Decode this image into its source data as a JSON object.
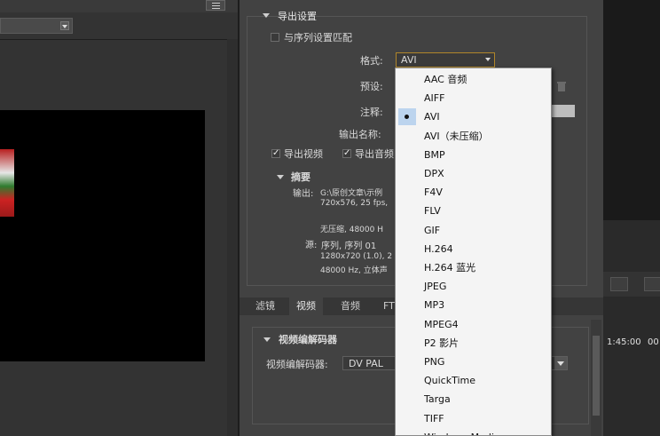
{
  "export_settings": {
    "section_title": "导出设置",
    "match_sequence_label": "与序列设置匹配",
    "format_label": "格式:",
    "format_value": "AVI",
    "preset_label": "预设:",
    "notes_label": "注释:",
    "output_name_label": "输出名称:",
    "export_video_label": "导出视频",
    "export_audio_label": "导出音频",
    "summary_title": "摘要",
    "output_label": "输出:",
    "output_path": "G:\\原创文章\\示例",
    "output_spec": "720x576, 25 fps,",
    "output_audio": "无压缩, 48000 H",
    "source_label": "源:",
    "source_sequence": "序列, 序列 01",
    "source_spec": "1280x720 (1.0), 2",
    "source_audio": "48000 Hz, 立体声"
  },
  "tabs": [
    {
      "label": "滤镜",
      "active": false
    },
    {
      "label": "视频",
      "active": true
    },
    {
      "label": "音频",
      "active": false
    },
    {
      "label": "FT",
      "active": false
    }
  ],
  "video_codec": {
    "section_title": "视频编解码器",
    "codec_label": "视频编解码器:",
    "codec_value": "DV PAL"
  },
  "format_dropdown": {
    "selected_index": 2,
    "options": [
      "AAC 音频",
      "AIFF",
      "AVI",
      "AVI（未压缩）",
      "BMP",
      "DPX",
      "F4V",
      "FLV",
      "GIF",
      "H.264",
      "H.264 蓝光",
      "JPEG",
      "MP3",
      "MPEG4",
      "P2 影片",
      "PNG",
      "QuickTime",
      "Targa",
      "TIFF",
      "Windows Media"
    ]
  },
  "timeline": {
    "timecode": "1:45:00",
    "timecode2": "00"
  },
  "colors": {
    "dialog_bg": "#424242",
    "highlight": "#bcd4ee",
    "format_border": "#b0862a"
  }
}
